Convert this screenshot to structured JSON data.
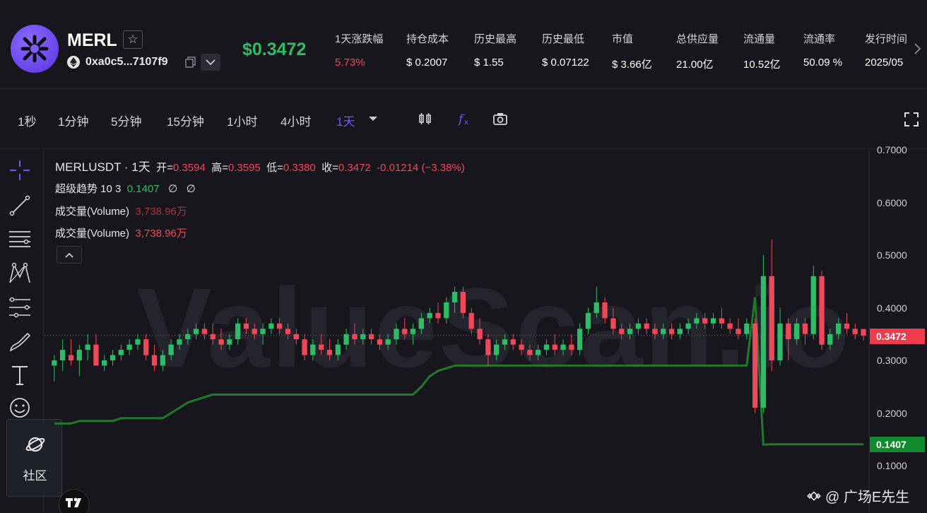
{
  "token": {
    "name": "MERL",
    "address": "0xa0c5...7107f9",
    "price": "$0.3472"
  },
  "stats": [
    {
      "label": "1天涨跌幅",
      "value": "5.73%",
      "color": "red"
    },
    {
      "label": "持仓成本",
      "value": "$ 0.2007"
    },
    {
      "label": "历史最高",
      "value": "$ 1.55"
    },
    {
      "label": "历史最低",
      "value": "$ 0.07122"
    },
    {
      "label": "市值",
      "value": "$ 3.66亿"
    },
    {
      "label": "总供应量",
      "value": "21.00亿"
    },
    {
      "label": "流通量",
      "value": "10.52亿"
    },
    {
      "label": "流通率",
      "value": "50.09 %"
    },
    {
      "label": "发行时间",
      "value": "2025/05"
    }
  ],
  "toolbar": {
    "timeframes": [
      "1秒",
      "1分钟",
      "5分钟",
      "15分钟",
      "1小时",
      "4小时",
      "1天"
    ],
    "active_timeframe": "1天"
  },
  "legend": {
    "symbol": "MERLUSDT · 1天",
    "open_label": "开=",
    "open": "0.3594",
    "high_label": "高=",
    "high": "0.3595",
    "low_label": "低=",
    "low": "0.3380",
    "close_label": "收=",
    "close": "0.3472",
    "change": "-0.01214 (−3.38%)",
    "supertrend_label": "超级趋势 10 3",
    "supertrend_value": "0.1407",
    "supertrend_na1": "∅",
    "supertrend_na2": "∅",
    "volume_label_1": "成交量(Volume)",
    "volume_value_1": "3,738.96万",
    "volume_label_2": "成交量(Volume)",
    "volume_value_2": "3,738.96万"
  },
  "watermark": "ValueScan.io",
  "price_tag": "0.3472",
  "supertrend_tag": "0.1407",
  "community_label": "社区",
  "source_tag": "@ 广场E先生",
  "colors": {
    "up": "#2ebd67",
    "down": "#f0485a",
    "supertrend": "#1f7a2c",
    "accent": "#6a5bff"
  },
  "chart_data": {
    "type": "candlestick",
    "y_axis_ticks": [
      "0.7000",
      "0.6000",
      "0.5000",
      "0.4000",
      "0.3000",
      "0.2000",
      "0.1000"
    ],
    "ylim": [
      0.05,
      0.7
    ],
    "current_price": 0.3472,
    "candles": [
      [
        0.29,
        0.31,
        0.26,
        0.3
      ],
      [
        0.3,
        0.34,
        0.28,
        0.32
      ],
      [
        0.31,
        0.34,
        0.29,
        0.3
      ],
      [
        0.3,
        0.33,
        0.27,
        0.32
      ],
      [
        0.32,
        0.35,
        0.3,
        0.33
      ],
      [
        0.33,
        0.35,
        0.29,
        0.29
      ],
      [
        0.29,
        0.31,
        0.28,
        0.3
      ],
      [
        0.3,
        0.32,
        0.29,
        0.31
      ],
      [
        0.31,
        0.33,
        0.3,
        0.32
      ],
      [
        0.32,
        0.34,
        0.31,
        0.33
      ],
      [
        0.33,
        0.35,
        0.32,
        0.34
      ],
      [
        0.34,
        0.35,
        0.3,
        0.31
      ],
      [
        0.31,
        0.33,
        0.28,
        0.29
      ],
      [
        0.29,
        0.32,
        0.28,
        0.31
      ],
      [
        0.31,
        0.34,
        0.3,
        0.33
      ],
      [
        0.33,
        0.35,
        0.32,
        0.34
      ],
      [
        0.34,
        0.36,
        0.33,
        0.35
      ],
      [
        0.35,
        0.37,
        0.34,
        0.36
      ],
      [
        0.36,
        0.37,
        0.34,
        0.35
      ],
      [
        0.35,
        0.37,
        0.33,
        0.34
      ],
      [
        0.34,
        0.36,
        0.32,
        0.33
      ],
      [
        0.33,
        0.35,
        0.32,
        0.34
      ],
      [
        0.34,
        0.38,
        0.33,
        0.37
      ],
      [
        0.37,
        0.38,
        0.35,
        0.36
      ],
      [
        0.36,
        0.37,
        0.34,
        0.35
      ],
      [
        0.35,
        0.37,
        0.33,
        0.36
      ],
      [
        0.36,
        0.38,
        0.35,
        0.37
      ],
      [
        0.37,
        0.38,
        0.35,
        0.36
      ],
      [
        0.36,
        0.37,
        0.34,
        0.35
      ],
      [
        0.35,
        0.36,
        0.33,
        0.34
      ],
      [
        0.34,
        0.35,
        0.3,
        0.31
      ],
      [
        0.31,
        0.34,
        0.3,
        0.33
      ],
      [
        0.33,
        0.35,
        0.31,
        0.32
      ],
      [
        0.32,
        0.34,
        0.3,
        0.31
      ],
      [
        0.31,
        0.34,
        0.3,
        0.33
      ],
      [
        0.33,
        0.36,
        0.32,
        0.35
      ],
      [
        0.35,
        0.37,
        0.33,
        0.34
      ],
      [
        0.34,
        0.36,
        0.33,
        0.35
      ],
      [
        0.35,
        0.36,
        0.33,
        0.34
      ],
      [
        0.34,
        0.35,
        0.32,
        0.33
      ],
      [
        0.33,
        0.35,
        0.32,
        0.34
      ],
      [
        0.34,
        0.37,
        0.33,
        0.36
      ],
      [
        0.36,
        0.38,
        0.34,
        0.35
      ],
      [
        0.35,
        0.37,
        0.33,
        0.36
      ],
      [
        0.36,
        0.39,
        0.35,
        0.38
      ],
      [
        0.38,
        0.4,
        0.37,
        0.39
      ],
      [
        0.39,
        0.41,
        0.37,
        0.38
      ],
      [
        0.38,
        0.42,
        0.37,
        0.41
      ],
      [
        0.41,
        0.44,
        0.39,
        0.43
      ],
      [
        0.43,
        0.44,
        0.38,
        0.39
      ],
      [
        0.39,
        0.4,
        0.35,
        0.36
      ],
      [
        0.36,
        0.38,
        0.33,
        0.34
      ],
      [
        0.34,
        0.35,
        0.29,
        0.31
      ],
      [
        0.31,
        0.34,
        0.3,
        0.33
      ],
      [
        0.33,
        0.35,
        0.32,
        0.34
      ],
      [
        0.34,
        0.35,
        0.32,
        0.33
      ],
      [
        0.33,
        0.34,
        0.31,
        0.32
      ],
      [
        0.32,
        0.33,
        0.3,
        0.31
      ],
      [
        0.31,
        0.33,
        0.3,
        0.32
      ],
      [
        0.32,
        0.34,
        0.31,
        0.33
      ],
      [
        0.33,
        0.35,
        0.31,
        0.32
      ],
      [
        0.32,
        0.34,
        0.31,
        0.33
      ],
      [
        0.33,
        0.35,
        0.31,
        0.32
      ],
      [
        0.32,
        0.37,
        0.31,
        0.36
      ],
      [
        0.36,
        0.4,
        0.35,
        0.39
      ],
      [
        0.39,
        0.44,
        0.38,
        0.41
      ],
      [
        0.41,
        0.42,
        0.37,
        0.38
      ],
      [
        0.38,
        0.4,
        0.35,
        0.36
      ],
      [
        0.36,
        0.37,
        0.34,
        0.35
      ],
      [
        0.35,
        0.37,
        0.34,
        0.36
      ],
      [
        0.36,
        0.38,
        0.35,
        0.37
      ],
      [
        0.37,
        0.38,
        0.35,
        0.36
      ],
      [
        0.36,
        0.37,
        0.34,
        0.35
      ],
      [
        0.35,
        0.37,
        0.34,
        0.36
      ],
      [
        0.36,
        0.37,
        0.34,
        0.35
      ],
      [
        0.35,
        0.37,
        0.34,
        0.36
      ],
      [
        0.36,
        0.38,
        0.35,
        0.37
      ],
      [
        0.37,
        0.39,
        0.36,
        0.38
      ],
      [
        0.38,
        0.39,
        0.36,
        0.37
      ],
      [
        0.37,
        0.39,
        0.36,
        0.38
      ],
      [
        0.38,
        0.4,
        0.36,
        0.37
      ],
      [
        0.37,
        0.38,
        0.35,
        0.36
      ],
      [
        0.36,
        0.38,
        0.34,
        0.35
      ],
      [
        0.35,
        0.38,
        0.34,
        0.37
      ],
      [
        0.37,
        0.38,
        0.2,
        0.21
      ],
      [
        0.21,
        0.5,
        0.2,
        0.46
      ],
      [
        0.46,
        0.53,
        0.28,
        0.3
      ],
      [
        0.3,
        0.4,
        0.29,
        0.37
      ],
      [
        0.37,
        0.38,
        0.3,
        0.34
      ],
      [
        0.34,
        0.38,
        0.33,
        0.37
      ],
      [
        0.37,
        0.38,
        0.33,
        0.35
      ],
      [
        0.35,
        0.48,
        0.34,
        0.46
      ],
      [
        0.46,
        0.47,
        0.32,
        0.33
      ],
      [
        0.33,
        0.36,
        0.32,
        0.35
      ],
      [
        0.35,
        0.38,
        0.34,
        0.37
      ],
      [
        0.37,
        0.39,
        0.35,
        0.36
      ],
      [
        0.36,
        0.37,
        0.34,
        0.35
      ],
      [
        0.3594,
        0.3595,
        0.338,
        0.3472
      ]
    ],
    "supertrend": [
      0.18,
      0.18,
      0.18,
      0.185,
      0.185,
      0.185,
      0.185,
      0.185,
      0.19,
      0.19,
      0.19,
      0.19,
      0.19,
      0.19,
      0.2,
      0.21,
      0.22,
      0.225,
      0.23,
      0.235,
      0.235,
      0.235,
      0.235,
      0.235,
      0.235,
      0.235,
      0.235,
      0.235,
      0.235,
      0.235,
      0.235,
      0.235,
      0.235,
      0.235,
      0.235,
      0.235,
      0.235,
      0.235,
      0.235,
      0.235,
      0.235,
      0.235,
      0.235,
      0.235,
      0.25,
      0.27,
      0.28,
      0.285,
      0.29,
      0.29,
      0.29,
      0.29,
      0.29,
      0.29,
      0.29,
      0.29,
      0.29,
      0.29,
      0.29,
      0.29,
      0.29,
      0.29,
      0.29,
      0.29,
      0.29,
      0.29,
      0.29,
      0.29,
      0.29,
      0.29,
      0.29,
      0.29,
      0.29,
      0.29,
      0.29,
      0.29,
      0.29,
      0.29,
      0.29,
      0.29,
      0.29,
      0.29,
      0.29,
      0.29,
      0.42,
      0.14,
      0.1407,
      0.1407,
      0.1407,
      0.1407,
      0.1407,
      0.1407,
      0.1407,
      0.1407,
      0.1407,
      0.1407,
      0.1407,
      0.1407
    ]
  }
}
